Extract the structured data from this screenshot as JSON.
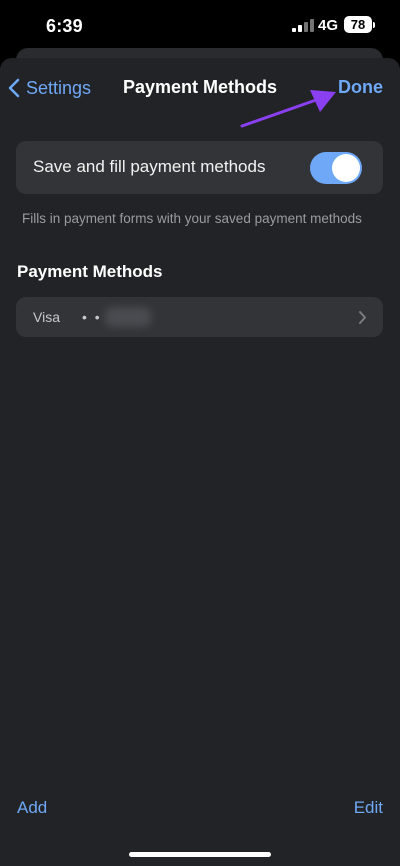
{
  "status_bar": {
    "time": "6:39",
    "network": "4G",
    "battery": "78",
    "icons": [
      "signal-icon",
      "battery-icon"
    ]
  },
  "nav": {
    "back_label": "Settings",
    "title": "Payment Methods",
    "done_label": "Done"
  },
  "save_fill": {
    "label": "Save and fill payment methods",
    "enabled": true,
    "footnote": "Fills in payment forms with your saved payment methods"
  },
  "section": {
    "title": "Payment Methods"
  },
  "payment_methods": [
    {
      "brand": "Visa",
      "masked": "• •"
    }
  ],
  "toolbar": {
    "add_label": "Add",
    "edit_label": "Edit"
  },
  "colors": {
    "accent": "#6ea8f7",
    "sheet_background": "#222326",
    "card_background": "#333438",
    "annotation_arrow": "#8a3ff0"
  }
}
